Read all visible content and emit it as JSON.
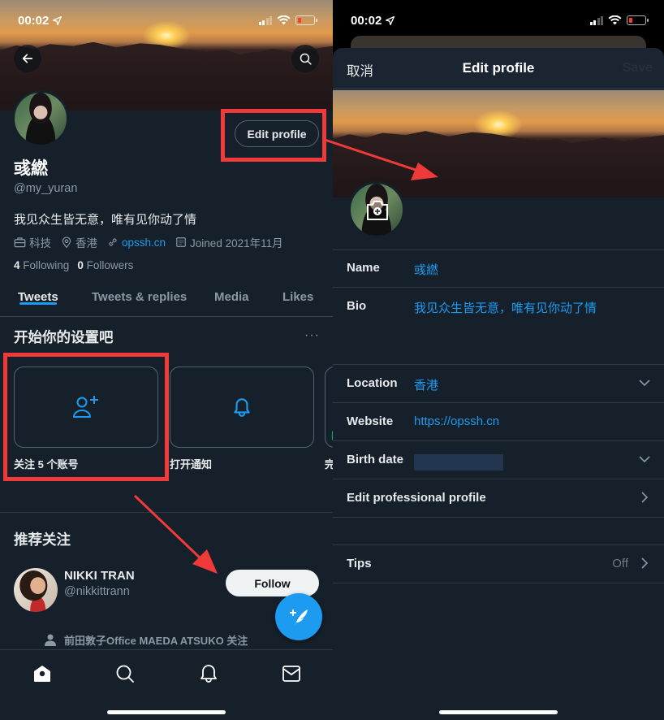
{
  "status_bar": {
    "time": "00:02"
  },
  "profile": {
    "display_name": "彧繎",
    "handle": "@my_yuran",
    "bio": "我见众生皆无意，唯有见你动了情",
    "category": "科技",
    "location": "香港",
    "website": "opssh.cn",
    "joined": "Joined 2021年11月",
    "following_count": "4",
    "following_label": "Following",
    "followers_count": "0",
    "followers_label": "Followers",
    "edit_button": "Edit profile"
  },
  "tabs": [
    {
      "label": "Tweets",
      "active": true
    },
    {
      "label": "Tweets & replies",
      "active": false
    },
    {
      "label": "Media",
      "active": false
    },
    {
      "label": "Likes",
      "active": false
    }
  ],
  "setup": {
    "title": "开始你的设置吧",
    "more": "···",
    "cards": [
      {
        "label": "关注 5 个账号",
        "icon": "add-user-icon"
      },
      {
        "label": "打开通知",
        "icon": "bell-icon"
      },
      {
        "label": "完"
      }
    ]
  },
  "recommended": {
    "title": "推荐关注",
    "users": [
      {
        "name": "NIKKI TRAN",
        "handle": "@nikkittrann",
        "follow_label": "Follow",
        "context": "前田敦子Office MAEDA ATSUKO 关注"
      }
    ]
  },
  "bottom_nav": [
    "home-icon",
    "search-icon",
    "bell-icon",
    "mail-icon"
  ],
  "edit_profile": {
    "cancel": "取消",
    "title": "Edit profile",
    "save": "Save",
    "fields": [
      {
        "label": "Name",
        "value": "彧繎"
      },
      {
        "label": "Bio",
        "value": "我见众生皆无意，唯有见你动了情"
      },
      {
        "label": "Location",
        "value": "香港"
      },
      {
        "label": "Website",
        "value": "https://opssh.cn"
      },
      {
        "label": "Birth date",
        "value": ""
      },
      {
        "label": "Edit professional profile"
      },
      {
        "label": "Tips",
        "value": "Off"
      }
    ]
  },
  "colors": {
    "background": "#15202b",
    "accent": "#1d9bf0",
    "highlight": "#f03a3a"
  }
}
